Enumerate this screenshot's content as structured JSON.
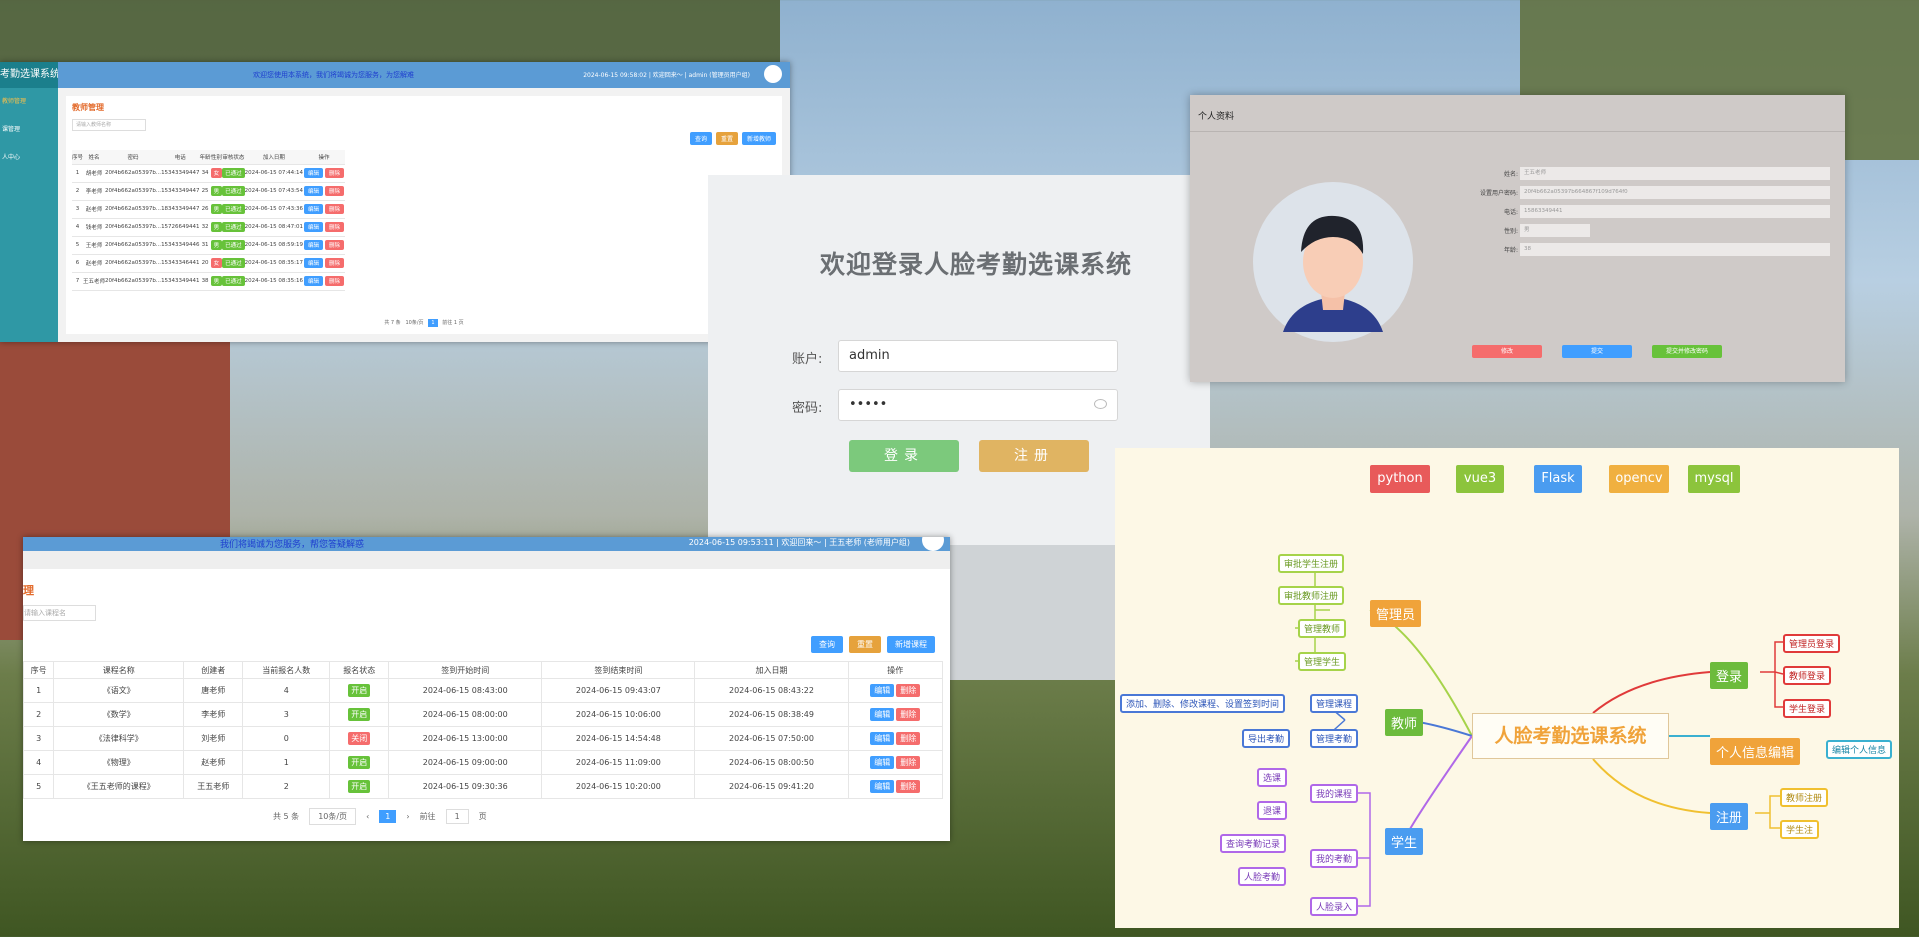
{
  "teacher_panel": {
    "logo": "考勤选课系统",
    "side_items": [
      "教师管理",
      "课管理",
      "人中心"
    ],
    "greeting": "欢迎您使用本系统，我们将竭诚为您服务，为您解难",
    "top_info": "2024-06-15 09:58:02 | 欢迎回来～ | admin (管理员用户组)",
    "title": "教师管理",
    "search_placeholder": "请输入教师名称",
    "btn_query": "查询",
    "btn_reset": "重置",
    "btn_add": "新增教师",
    "headers": [
      "序号",
      "姓名",
      "密码",
      "电话",
      "年龄",
      "性别",
      "审核状态",
      "加入日期",
      "操作"
    ],
    "rows": [
      {
        "no": "1",
        "name": "胡老师",
        "pwd": "20f4b662a05397b...",
        "phone": "15343349447",
        "age": "34",
        "sex": "女",
        "status": "已通过",
        "date": "2024-06-15 07:44:14"
      },
      {
        "no": "2",
        "name": "李老师",
        "pwd": "20f4b662a05397b...",
        "phone": "15343349447",
        "age": "25",
        "sex": "男",
        "status": "已通过",
        "date": "2024-06-15 07:43:54"
      },
      {
        "no": "3",
        "name": "赵老师",
        "pwd": "20f4b662a05397b...",
        "phone": "18343349447",
        "age": "26",
        "sex": "男",
        "status": "已通过",
        "date": "2024-06-15 07:43:36"
      },
      {
        "no": "4",
        "name": "钱老师",
        "pwd": "20f4b662a05397b...",
        "phone": "15726649441",
        "age": "32",
        "sex": "男",
        "status": "已通过",
        "date": "2024-06-15 08:47:01"
      },
      {
        "no": "5",
        "name": "王老师",
        "pwd": "20f4b662a05397b...",
        "phone": "15343349446",
        "age": "31",
        "sex": "男",
        "status": "已通过",
        "date": "2024-06-15 08:59:19"
      },
      {
        "no": "6",
        "name": "赵老师",
        "pwd": "20f4b662a05397b...",
        "phone": "15343346441",
        "age": "20",
        "sex": "女",
        "status": "已通过",
        "date": "2024-06-15 08:35:17"
      },
      {
        "no": "7",
        "name": "王五老师",
        "pwd": "20f4b662a05397b...",
        "phone": "15343349441",
        "age": "38",
        "sex": "男",
        "status": "已通过",
        "date": "2024-06-15 08:35:16"
      }
    ],
    "op_edit": "编辑",
    "op_del": "删除",
    "pager_total": "共 7 条",
    "pager_size": "10条/页",
    "pager_page": "1",
    "pager_goto": "前往",
    "pager_goto_val": "1",
    "pager_unit": "页"
  },
  "login": {
    "title": "欢迎登录人脸考勤选课系统",
    "account_label": "账户:",
    "account_value": "admin",
    "password_label": "密码:",
    "password_value": "•••••",
    "login_btn": "登录",
    "register_btn": "注册"
  },
  "profile": {
    "title": "个人资料",
    "fields": [
      {
        "k": "姓名:",
        "v": "王五老师"
      },
      {
        "k": "设置用户密码:",
        "v": "20f4b662a05397b664867f109d764f0"
      },
      {
        "k": "电话:",
        "v": "15863349441"
      },
      {
        "k": "性别:",
        "v": "男"
      },
      {
        "k": "年龄:",
        "v": "38"
      }
    ],
    "btn_edit": "修改",
    "btn_submit": "提交",
    "btn_pwd": "提交并修改密码"
  },
  "course_panel": {
    "greeting": "我们将竭诚为您服务，帮您答疑解惑",
    "top_info": "2024-06-15 09:53:11 | 欢迎回来～ | 王五老师 (老师用户组)",
    "title": "理",
    "search_placeholder": "请输入课程名",
    "btn_query": "查询",
    "btn_reset": "重置",
    "btn_add": "新增课程",
    "headers": [
      "序号",
      "课程名称",
      "创建者",
      "当前报名人数",
      "报名状态",
      "签到开始时间",
      "签到结束时间",
      "加入日期",
      "操作"
    ],
    "rows": [
      {
        "no": "1",
        "name": "《语文》",
        "creator": "唐老师",
        "count": "4",
        "status": "开启",
        "start": "2024-06-15 08:43:00",
        "end": "2024-06-15 09:43:07",
        "date": "2024-06-15 08:43:22"
      },
      {
        "no": "2",
        "name": "《数学》",
        "creator": "李老师",
        "count": "3",
        "status": "开启",
        "start": "2024-06-15 08:00:00",
        "end": "2024-06-15 10:06:00",
        "date": "2024-06-15 08:38:49"
      },
      {
        "no": "3",
        "name": "《法律科学》",
        "creator": "刘老师",
        "count": "0",
        "status": "关闭",
        "start": "2024-06-15 13:00:00",
        "end": "2024-06-15 14:54:48",
        "date": "2024-06-15 07:50:00"
      },
      {
        "no": "4",
        "name": "《物理》",
        "creator": "赵老师",
        "count": "1",
        "status": "开启",
        "start": "2024-06-15 09:00:00",
        "end": "2024-06-15 11:09:00",
        "date": "2024-06-15 08:00:50"
      },
      {
        "no": "5",
        "name": "《王五老师的课程》",
        "creator": "王五老师",
        "count": "2",
        "status": "开启",
        "start": "2024-06-15 09:30:36",
        "end": "2024-06-15 10:20:00",
        "date": "2024-06-15 09:41:20"
      }
    ],
    "op_edit": "编辑",
    "op_del": "删除",
    "pager_total": "共 5 条",
    "pager_size": "10条/页",
    "pager_page": "1",
    "pager_goto": "前往",
    "pager_goto_val": "1",
    "pager_unit": "页"
  },
  "mindmap": {
    "tech": [
      "python",
      "vue3",
      "Flask",
      "opencv",
      "mysql"
    ],
    "center": "人脸考勤选课系统",
    "admin": "管理员",
    "admin_items": [
      "审批学生注册",
      "审批教师注册",
      "管理教师",
      "管理学生"
    ],
    "teacher": "教师",
    "teacher_items": [
      "管理课程",
      "管理考勤"
    ],
    "teacher_course_note": "添加、删除、修改课程、设置签到时间",
    "teacher_att_note": "导出考勤",
    "student": "学生",
    "student_items": [
      "我的课程",
      "我的考勤",
      "人脸录入"
    ],
    "student_course_notes": [
      "选课",
      "退课"
    ],
    "student_att_notes": [
      "查询考勤记录",
      "人脸考勤"
    ],
    "login": "登录",
    "login_items": [
      "管理员登录",
      "教师登录",
      "学生登录"
    ],
    "info": "个人信息编辑",
    "info_item": "编辑个人信息",
    "register": "注册",
    "register_items": [
      "教师注册",
      "学生注"
    ]
  }
}
